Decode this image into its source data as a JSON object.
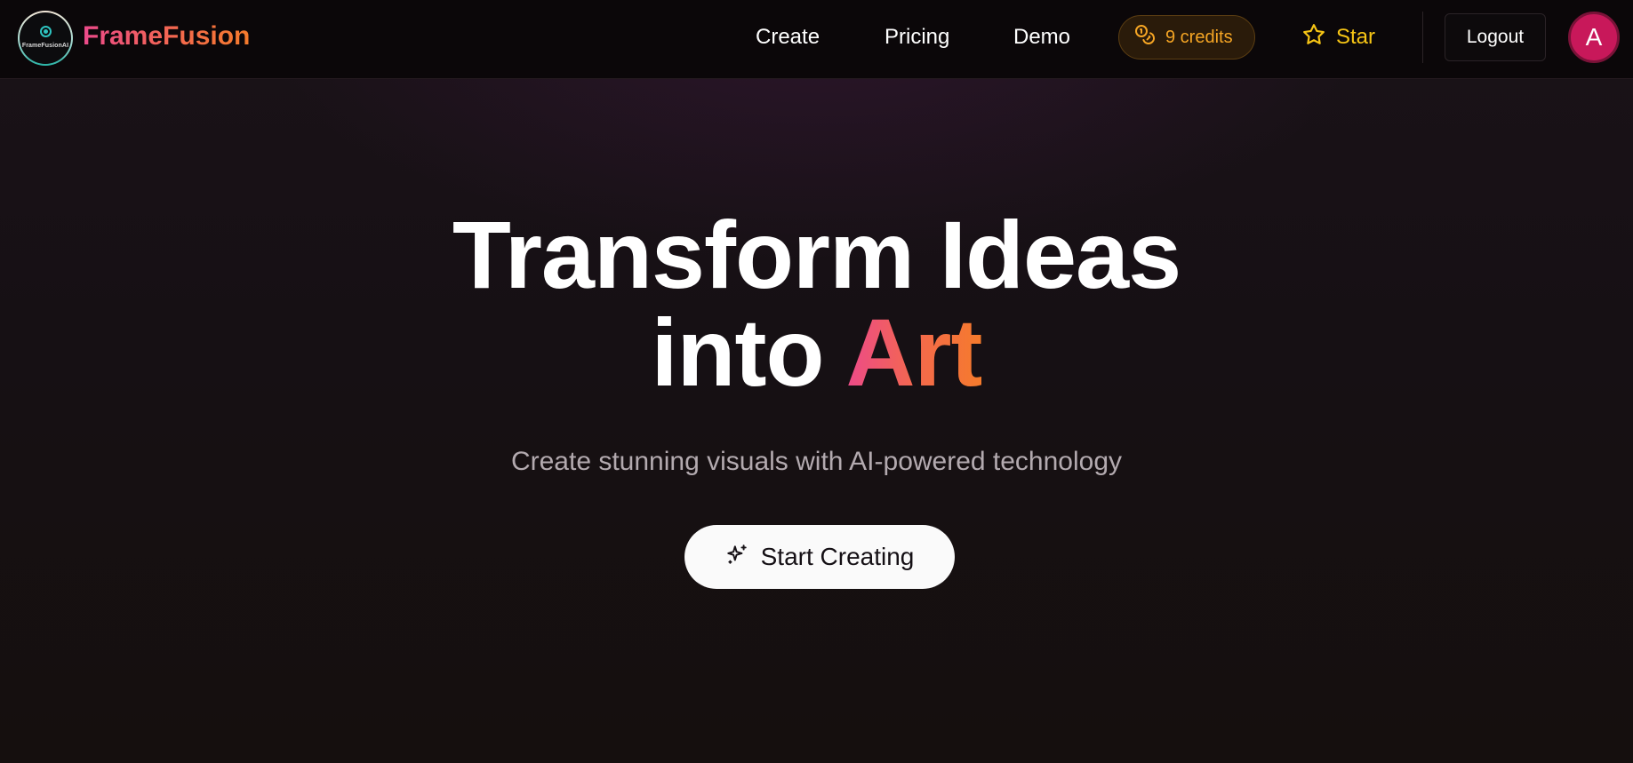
{
  "header": {
    "logo_text": "FrameFusionAI",
    "brand": "FrameFusion",
    "nav": [
      {
        "label": "Create"
      },
      {
        "label": "Pricing"
      },
      {
        "label": "Demo"
      }
    ],
    "credits_label": "9 credits",
    "star_label": "Star",
    "logout_label": "Logout",
    "avatar_initial": "A"
  },
  "hero": {
    "title_line1": "Transform Ideas",
    "title_line2_prefix": "into ",
    "title_line2_accent": "Art",
    "subtitle": "Create stunning visuals with AI-powered technology",
    "cta_label": "Start Creating",
    "cta_icon": "sparkles-icon"
  },
  "colors": {
    "accent_start": "#ec4a8a",
    "accent_end": "#f57b2c",
    "credits": "#f5a524",
    "star": "#f7c515",
    "avatar": "#c8185a"
  }
}
